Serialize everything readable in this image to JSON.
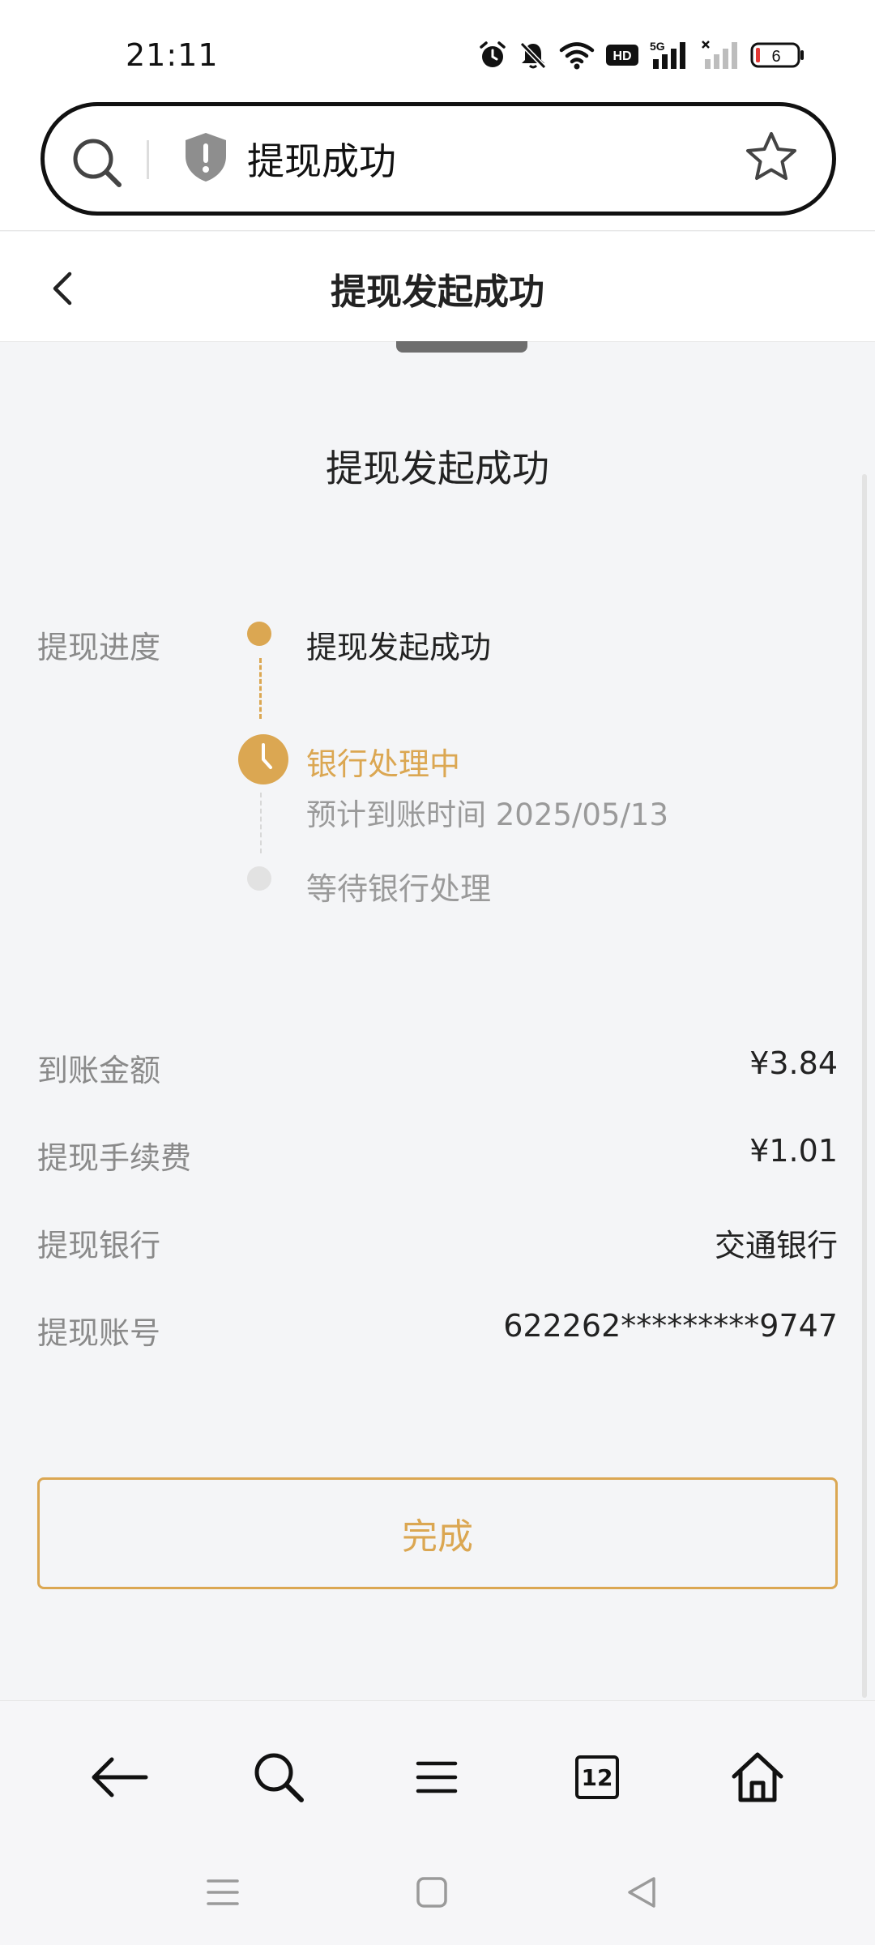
{
  "status_bar": {
    "time": "21:11",
    "network_label": "5G",
    "hd_label": "HD",
    "battery_level": "6",
    "icons": [
      "alarm-icon",
      "mute-icon",
      "wifi-icon",
      "hd-icon",
      "signal-5g-icon",
      "signal-none-icon",
      "battery-icon"
    ]
  },
  "browser": {
    "url_text": "提现成功",
    "tab_count": "12"
  },
  "header": {
    "title": "提现发起成功"
  },
  "main": {
    "heading": "提现发起成功",
    "progress": {
      "label": "提现进度",
      "steps": [
        {
          "title": "提现发起成功",
          "state": "done"
        },
        {
          "title": "银行处理中",
          "subtitle": "预计到账时间 2025/05/13",
          "state": "current"
        },
        {
          "title": "等待银行处理",
          "state": "pending"
        }
      ]
    },
    "details": [
      {
        "label": "到账金额",
        "value": "¥3.84"
      },
      {
        "label": "提现手续费",
        "value": "¥1.01"
      },
      {
        "label": "提现银行",
        "value": "交通银行"
      },
      {
        "label": "提现账号",
        "value": "622262*********9747"
      }
    ],
    "done_button": "完成"
  },
  "colors": {
    "accent": "#dba752",
    "background": "#f4f5f7",
    "text_primary": "#222222",
    "text_secondary": "#8a8a8a"
  }
}
